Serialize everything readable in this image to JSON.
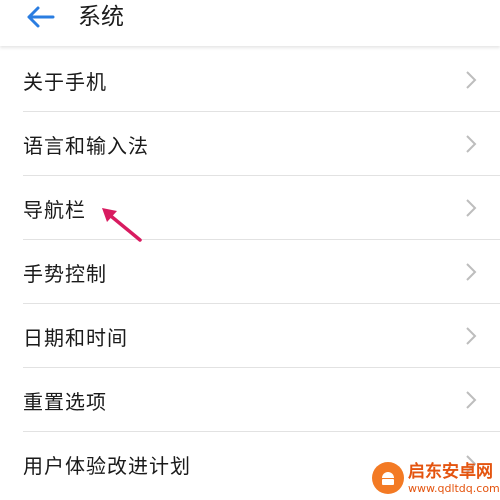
{
  "header": {
    "title": "系统",
    "back_icon": "arrow-left-icon"
  },
  "colors": {
    "accent": "#2a7de1",
    "annotation_arrow": "#d81b60",
    "watermark": "#e4540f"
  },
  "menu": {
    "items": [
      {
        "label": "关于手机"
      },
      {
        "label": "语言和输入法"
      },
      {
        "label": "导航栏"
      },
      {
        "label": "手势控制"
      },
      {
        "label": "日期和时间"
      },
      {
        "label": "重置选项"
      },
      {
        "label": "用户体验改进计划"
      }
    ]
  },
  "watermark": {
    "name": "启东安卓网",
    "url": "www.qdltdq.com"
  }
}
